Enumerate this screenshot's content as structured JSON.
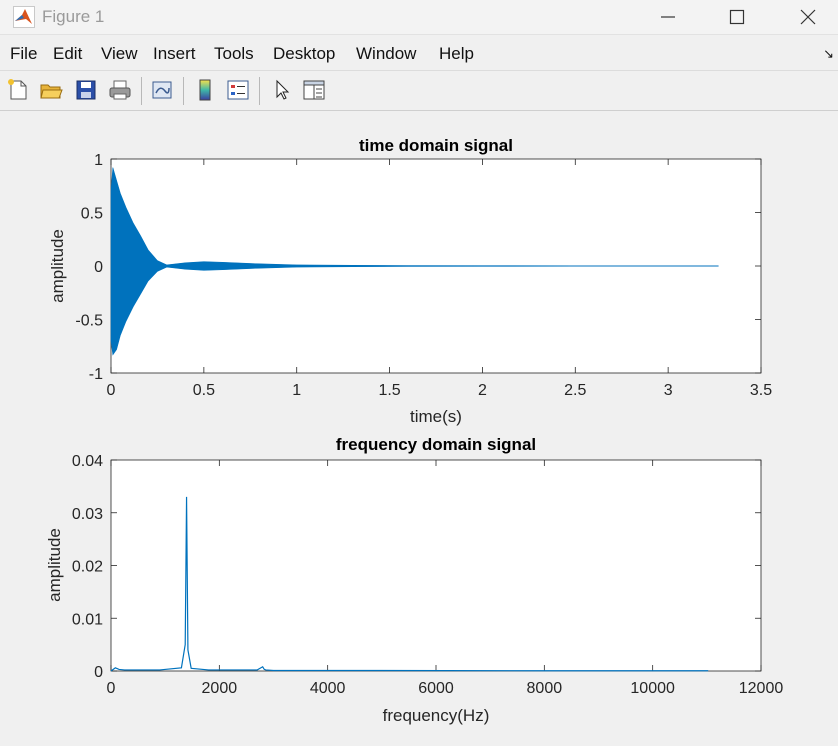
{
  "window": {
    "title": "Figure 1"
  },
  "menu": [
    "File",
    "Edit",
    "View",
    "Insert",
    "Tools",
    "Desktop",
    "Window",
    "Help"
  ],
  "toolbar_icons": [
    "new-figure-icon",
    "open-file-icon",
    "save-icon",
    "print-icon",
    "link-plot-icon",
    "insert-colorbar-icon",
    "insert-legend-icon",
    "pointer-icon",
    "property-inspector-icon"
  ],
  "chart_data": [
    {
      "type": "line",
      "title": "time domain signal",
      "xlabel": "time(s)",
      "ylabel": "amplitude",
      "xlim": [
        0,
        3.5
      ],
      "ylim": [
        -1,
        1
      ],
      "xticks": [
        "0",
        "0.5",
        "1",
        "1.5",
        "2",
        "2.5",
        "3",
        "3.5"
      ],
      "yticks": [
        "1",
        "0.5",
        "0",
        "-0.5",
        "-1"
      ],
      "color": "#0072BD",
      "envelope": {
        "x": [
          0,
          0.01,
          0.03,
          0.05,
          0.08,
          0.12,
          0.16,
          0.2,
          0.25,
          0.3,
          0.4,
          0.5,
          0.6,
          0.8,
          1.0,
          1.3,
          1.6,
          2.0,
          2.5,
          3.0,
          3.27
        ],
        "upper": [
          0.7,
          0.92,
          0.8,
          0.68,
          0.55,
          0.4,
          0.28,
          0.15,
          0.05,
          0.01,
          0.03,
          0.04,
          0.035,
          0.02,
          0.01,
          0.006,
          0.004,
          0.003,
          0.002,
          0.002,
          0.002
        ],
        "lower": [
          -0.7,
          -0.83,
          -0.78,
          -0.65,
          -0.52,
          -0.38,
          -0.26,
          -0.14,
          -0.05,
          -0.01,
          -0.03,
          -0.04,
          -0.035,
          -0.02,
          -0.01,
          -0.006,
          -0.004,
          -0.003,
          -0.002,
          -0.002,
          -0.002
        ]
      }
    },
    {
      "type": "line",
      "title": "frequency domain signal",
      "xlabel": "frequency(Hz)",
      "ylabel": "amplitude",
      "xlim": [
        0,
        12000
      ],
      "ylim": [
        0,
        0.04
      ],
      "xticks": [
        "0",
        "2000",
        "4000",
        "6000",
        "8000",
        "10000",
        "12000"
      ],
      "yticks": [
        "0.04",
        "0.03",
        "0.02",
        "0.01",
        "0"
      ],
      "color": "#0072BD",
      "x": [
        0,
        80,
        150,
        250,
        500,
        900,
        1300,
        1370,
        1395,
        1420,
        1480,
        1800,
        2700,
        2800,
        2830,
        2860,
        3000,
        5000,
        8000,
        11025
      ],
      "y": [
        0.0,
        0.0006,
        0.0003,
        0.0002,
        0.0002,
        0.0002,
        0.0006,
        0.005,
        0.033,
        0.004,
        0.0005,
        0.0002,
        0.0002,
        0.0008,
        0.0003,
        0.0002,
        0.0001,
        0.0001,
        5e-05,
        5e-05
      ]
    }
  ]
}
